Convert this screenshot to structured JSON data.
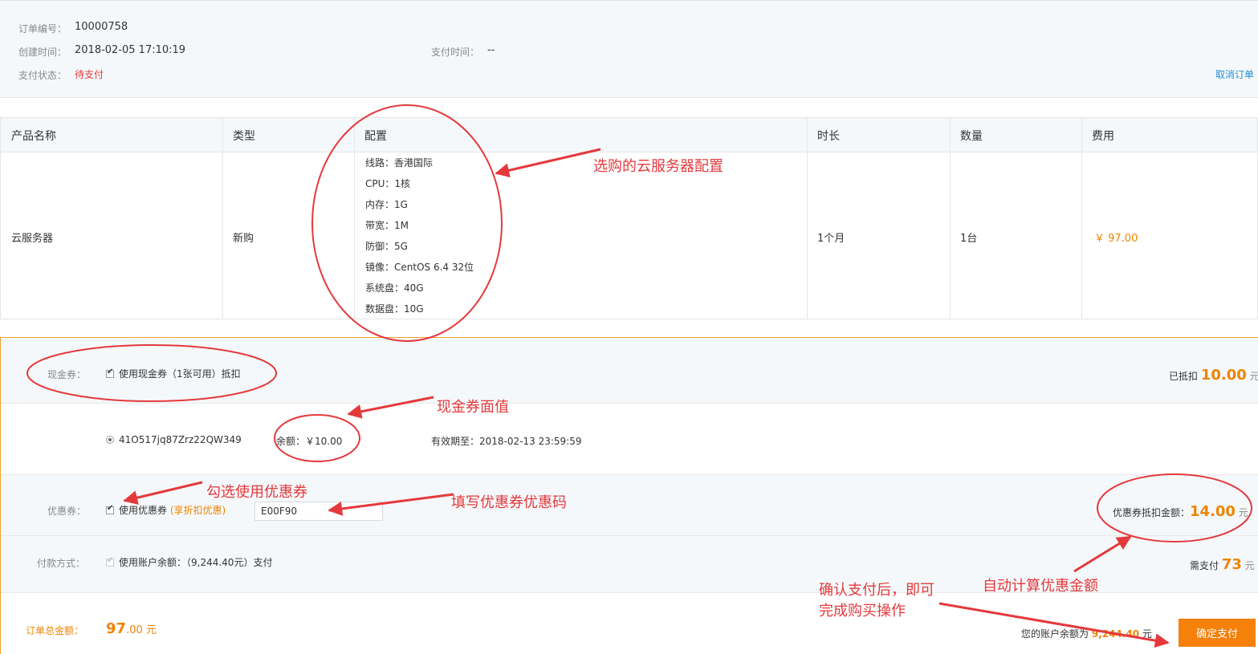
{
  "order": {
    "number_label": "订单编号：",
    "number": "10000758",
    "created_label": "创建时间：",
    "created": "2018-02-05 17:10:19",
    "paid_time_label": "支付时间：",
    "paid_time": "--",
    "status_label": "支付状态：",
    "status": "待支付",
    "cancel_link": "取消订单"
  },
  "table": {
    "headers": [
      "产品名称",
      "类型",
      "配置",
      "时长",
      "数量",
      "费用"
    ],
    "row": {
      "product": "云服务器",
      "type": "新购",
      "config": [
        "线路：香港国际",
        "CPU：1核",
        "内存：1G",
        "带宽：1M",
        "防御：5G",
        "镜像：CentOS 6.4 32位",
        "系统盘：40G",
        "数据盘：10G"
      ],
      "duration": "1个月",
      "quantity": "1台",
      "fee": "￥ 97.00"
    }
  },
  "cash_voucher": {
    "label": "现金券：",
    "checkbox_label": "使用现金券（1张可用）抵扣",
    "deducted_label": "已抵扣",
    "deducted_amount": "10.00",
    "unit": "元",
    "voucher_code": "41O517jq87Zrz22QW349",
    "balance_label": "余额：",
    "balance": "￥10.00",
    "expiry_label": "有效期至：",
    "expiry": "2018-02-13 23:59:59"
  },
  "coupon": {
    "label": "优惠券：",
    "checkbox_label": "使用优惠券",
    "discount_hint": "(享折扣优惠)",
    "code_value": "E00F90",
    "discount_label": "优惠券抵扣金额：",
    "discount_amount": "14.00",
    "unit": "元"
  },
  "payment": {
    "label": "付款方式：",
    "checkbox_label": "使用账户余额：（9,244.40元）支付",
    "need_pay_label": "需支付",
    "need_pay_amount": "73",
    "unit": "元"
  },
  "total": {
    "label": "订单总金额：",
    "amount_int": "97",
    "amount_dec": ".00 元",
    "balance_label": "您的账户余额为",
    "balance": "9,244.40",
    "balance_unit": "元",
    "confirm_button": "确定支付"
  },
  "annotations": {
    "config": "选购的云服务器配置",
    "voucher_value": "现金券面值",
    "use_coupon": "勾选使用优惠券",
    "fill_coupon": "填写优惠券优惠码",
    "auto_calc": "自动计算优惠金额",
    "confirm_line1": "确认支付后，即可",
    "confirm_line2": "完成购买操作"
  },
  "colors": {
    "accent": "#f08300",
    "annotation_red": "#e4393c",
    "link_blue": "#1f8fd8",
    "button_orange": "#f5800a"
  }
}
